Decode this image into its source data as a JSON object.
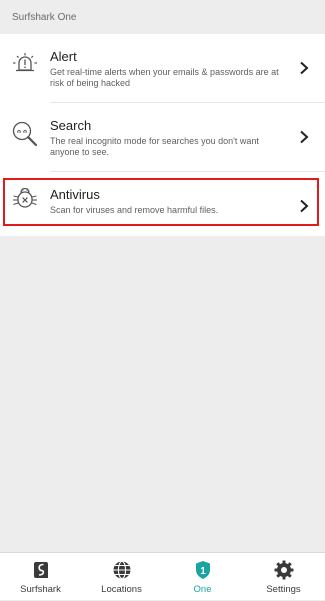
{
  "header": {
    "title": "Surfshark One"
  },
  "items": [
    {
      "title": "Alert",
      "description": "Get real-time alerts when your emails & passwords are at risk of being hacked",
      "icon": "alert-bell-icon"
    },
    {
      "title": "Search",
      "description": "The real incognito mode for searches you don't want anyone to see.",
      "icon": "search-magnifier-icon"
    },
    {
      "title": "Antivirus",
      "description": "Scan for viruses and remove harmful files.",
      "icon": "antivirus-bug-icon"
    }
  ],
  "nav": {
    "items": [
      {
        "label": "Surfshark",
        "icon": "surfshark-logo-icon"
      },
      {
        "label": "Locations",
        "icon": "globe-icon"
      },
      {
        "label": "One",
        "icon": "shield-one-icon",
        "badge": "1"
      },
      {
        "label": "Settings",
        "icon": "gear-icon"
      }
    ],
    "active": "One"
  },
  "colors": {
    "accent": "#1aa3a3",
    "highlight": "#e11b1b",
    "background": "#ededed"
  }
}
